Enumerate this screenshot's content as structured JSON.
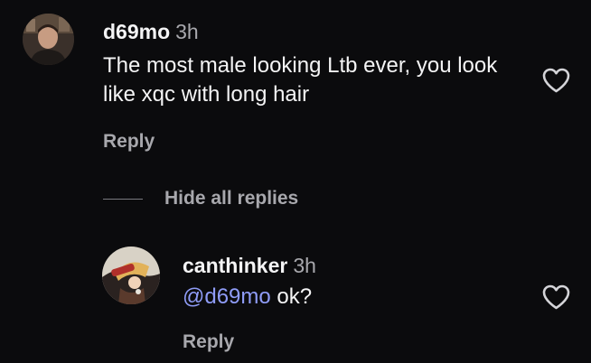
{
  "comments": [
    {
      "username": "d69mo",
      "time": "3h",
      "text": "The most male looking Ltb ever, you look like xqc with long hair",
      "reply_label": "Reply"
    }
  ],
  "thread": {
    "hide_replies_label": "Hide all replies"
  },
  "replies": [
    {
      "username": "canthinker",
      "time": "3h",
      "mention": "@d69mo",
      "text": " ok?",
      "reply_label": "Reply"
    }
  ],
  "icons": {
    "like": "heart-outline-icon"
  },
  "colors": {
    "background": "#0b0b0d",
    "text": "#f4f4f5",
    "muted": "#a8a8ad",
    "mention": "#8f9cf7"
  }
}
